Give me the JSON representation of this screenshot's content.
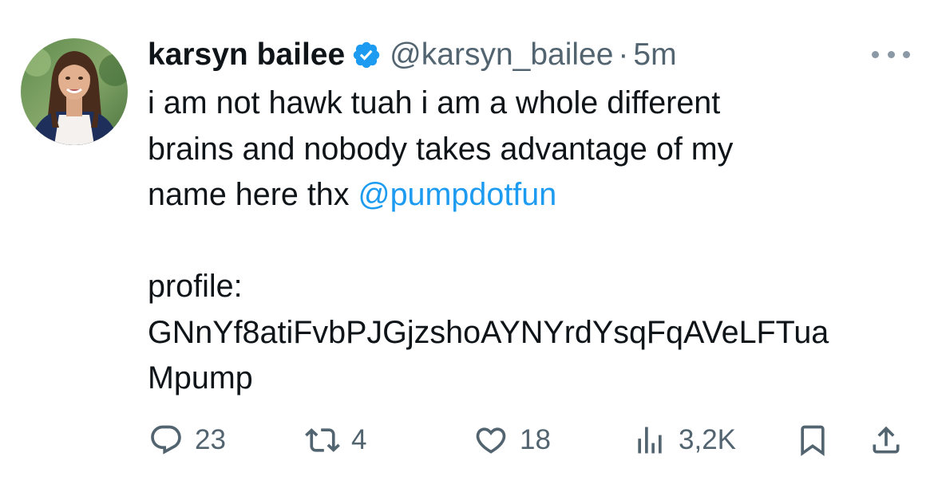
{
  "author": {
    "name": "karsyn bailee",
    "handle": "@karsyn_bailee",
    "separator": "·",
    "time": "5m",
    "verified": true
  },
  "tweet": {
    "line1": "i am not hawk tuah i am a whole different",
    "line2": "brains and nobody takes advantage of my",
    "line3_text": "name here thx ",
    "mention": "@pumpdotfun",
    "line5": "profile:",
    "line6": "GNnYf8atiFvbPJGjzshoAYNYrdYsqFqAVeLFTua",
    "line7": "Mpump"
  },
  "actions": {
    "replies": "23",
    "retweets": "4",
    "likes": "18",
    "views": "3,2K"
  },
  "colors": {
    "accent": "#1d9bf0",
    "text": "#0f1419",
    "muted": "#536471"
  },
  "icons": [
    "reply-icon",
    "retweet-icon",
    "like-icon",
    "views-icon",
    "bookmark-icon",
    "share-icon",
    "more-icon",
    "verified-badge-icon"
  ]
}
